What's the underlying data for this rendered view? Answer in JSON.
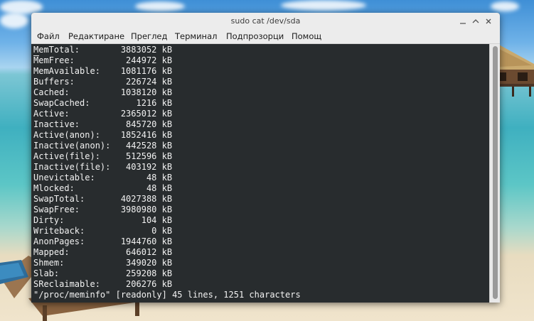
{
  "window": {
    "title": "sudo cat /dev/sda"
  },
  "menu": [
    "Файл",
    "Редактиране",
    "Преглед",
    "Терминал",
    "Подпрозорци",
    "Помощ"
  ],
  "terminal": {
    "lines": [
      "MemTotal:        3883052 kB",
      "MemFree:          244972 kB",
      "MemAvailable:    1081176 kB",
      "Buffers:          226724 kB",
      "Cached:          1038120 kB",
      "SwapCached:         1216 kB",
      "Active:          2365012 kB",
      "Inactive:         845720 kB",
      "Active(anon):    1852416 kB",
      "Inactive(anon):   442528 kB",
      "Active(file):     512596 kB",
      "Inactive(file):   403192 kB",
      "Unevictable:          48 kB",
      "Mlocked:              48 kB",
      "SwapTotal:       4027388 kB",
      "SwapFree:        3980980 kB",
      "Dirty:               104 kB",
      "Writeback:             0 kB",
      "AnonPages:       1944760 kB",
      "Mapped:           646012 kB",
      "Shmem:            349020 kB",
      "Slab:             259208 kB",
      "SReclaimable:     206276 kB"
    ],
    "status_line": "\"/proc/meminfo\" [readonly] 45 lines, 1251 characters"
  },
  "colors": {
    "terminal_bg": "#2c3032",
    "terminal_fg": "#f2f2f2",
    "titlebar_bg": "#ececec"
  },
  "icons": {
    "minimize": "minimize-icon",
    "maximize": "maximize-icon",
    "close": "close-icon"
  }
}
